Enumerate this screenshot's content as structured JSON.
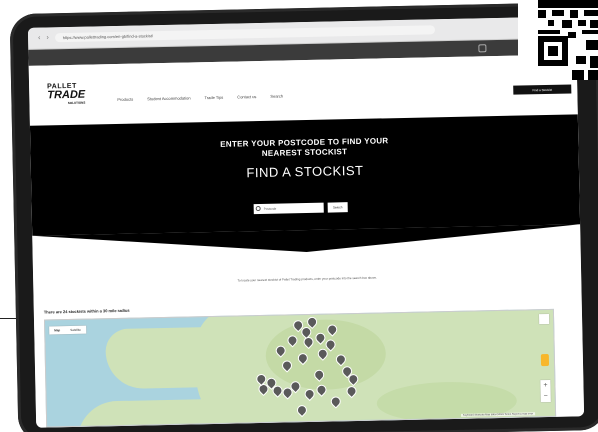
{
  "browser": {
    "url": "https://www.pallettrading.com/en-gb/find-a-stockist/",
    "back_glyph": "‹",
    "forward_glyph": "›"
  },
  "header": {
    "logo_line1": "PALLET",
    "logo_line2": "TRADE",
    "logo_line3": "SOLUTIONS",
    "nav": [
      "Products",
      "Student Accommodation",
      "Trade Tips",
      "Contact us",
      "Search"
    ],
    "cta_label": "Find a Stockist"
  },
  "hero": {
    "subtitle": "ENTER YOUR POSTCODE TO FIND YOUR\nNEAREST STOCKIST",
    "title": "FIND A STOCKIST",
    "search_placeholder": "Postcode",
    "search_button": "Search"
  },
  "body": {
    "instructions": "To locate your nearest stockist of Pallet Trading products, enter your postcode into the search box above.",
    "result_count": "There are 24 stockists within a 30 mile radius"
  },
  "map": {
    "toggle": [
      "Map",
      "Satellite"
    ],
    "active": "Map",
    "zoom_in": "+",
    "zoom_out": "−",
    "attribution": "Keyboard shortcuts   Map data ©2023   Terms   Report a map error",
    "colors": {
      "water": "#aad3df",
      "land": "#cfe2b8",
      "marker": "#5a5a5a"
    },
    "marker_count": 27
  },
  "icons": [
    "search-icon",
    "share-icon",
    "fullscreen-icon",
    "pegman-icon",
    "map-marker-icon",
    "qr-code"
  ]
}
